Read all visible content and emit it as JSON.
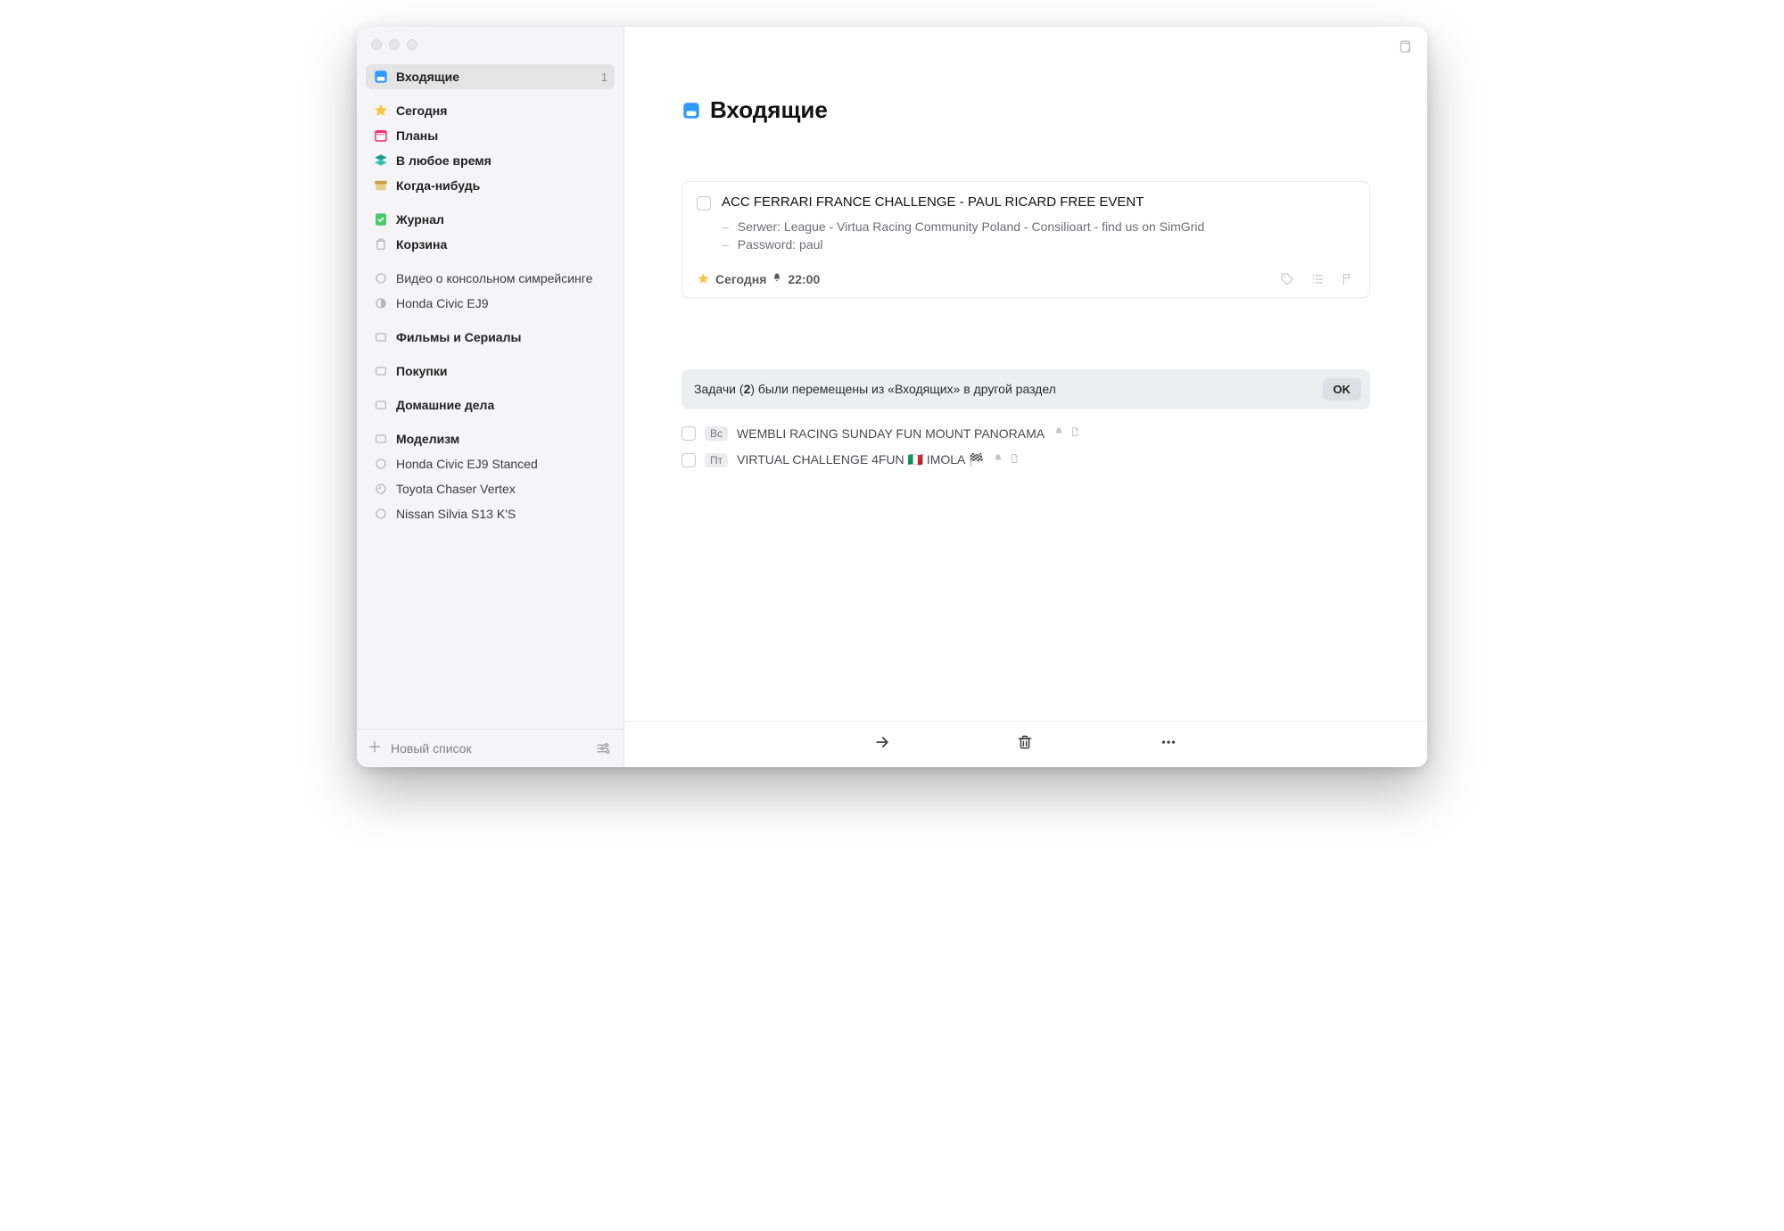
{
  "sidebar": {
    "inbox_label": "Входящие",
    "inbox_count": "1",
    "today_label": "Сегодня",
    "upcoming_label": "Планы",
    "anytime_label": "В любое время",
    "someday_label": "Когда-нибудь",
    "logbook_label": "Журнал",
    "trash_label": "Корзина",
    "proj1_label": "Видео о консольном симрейсинге",
    "proj2_label": "Honda Civic EJ9",
    "area1_label": "Фильмы и Сериалы",
    "area2_label": "Покупки",
    "area3_label": "Домашние дела",
    "area4_label": "Моделизм",
    "area4_p1_label": "Honda Civic EJ9 Stanced",
    "area4_p2_label": "Toyota Chaser Vertex",
    "area4_p3_label": "Nissan Silvia S13 K'S",
    "footer": {
      "new_list_label": "Новый список"
    }
  },
  "main": {
    "title": "Входящие",
    "card": {
      "title": "ACC FERRARI FRANCE CHALLENGE - PAUL RICARD FREE EVENT",
      "note1": "Serwer: League - Virtua Racing Community Poland - Consilioart - find us on SimGrid",
      "note2": "Password: paul",
      "when_label": "Сегодня",
      "reminder_time": "22:00"
    },
    "notice_pre": "Задачи (",
    "notice_count": "2",
    "notice_post": ") были перемещены из «Входящих» в другой раздел",
    "notice_ok": "OK",
    "row1_day": "Вс",
    "row1_title": "WEMBLI RACING  SUNDAY FUN MOUNT PANORAMA",
    "row2_day": "Пт",
    "row2_title": "VIRTUAL CHALLENGE 4FUN 🇮🇹 IMOLA 🏁"
  }
}
